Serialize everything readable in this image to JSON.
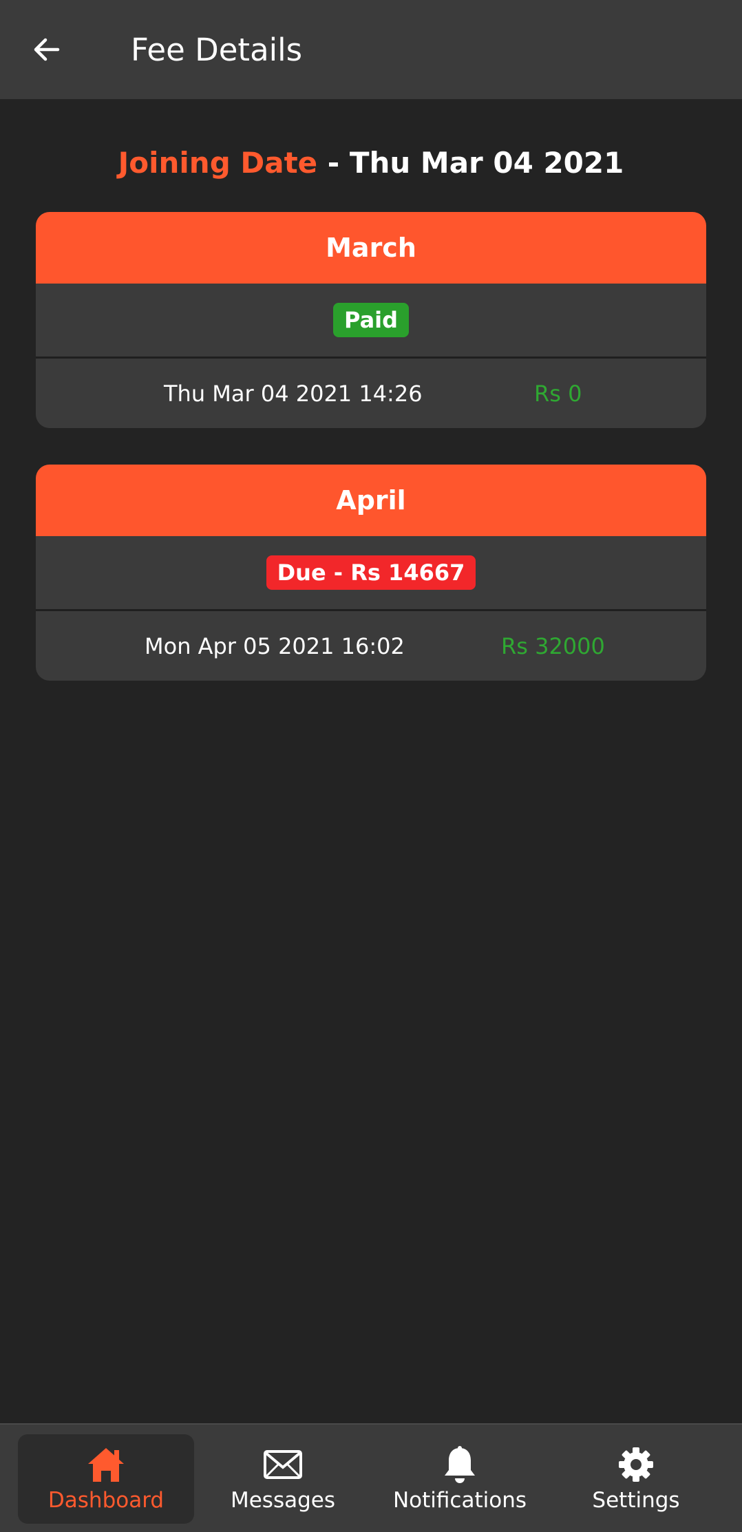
{
  "appbar": {
    "title": "Fee Details",
    "back_icon": "arrow-left-icon"
  },
  "joining": {
    "label": "Joining Date",
    "separator": " - ",
    "date": "Thu Mar 04 2021"
  },
  "colors": {
    "accent": "#ff562d",
    "paid": "#2aa02c",
    "due": "#f2272a",
    "amount": "#2fa832"
  },
  "fees": [
    {
      "month": "March",
      "status": "Paid",
      "status_type": "paid",
      "datetime": "Thu Mar 04 2021 14:26",
      "amount": "Rs 0"
    },
    {
      "month": "April",
      "status": "Due - Rs 14667",
      "status_type": "due",
      "datetime": "Mon Apr 05 2021 16:02",
      "amount": "Rs 32000"
    }
  ],
  "nav": {
    "items": [
      {
        "label": "Dashboard",
        "icon": "home-icon",
        "active": true
      },
      {
        "label": "Messages",
        "icon": "envelope-icon",
        "active": false
      },
      {
        "label": "Notifications",
        "icon": "bell-icon",
        "active": false
      },
      {
        "label": "Settings",
        "icon": "gear-icon",
        "active": false
      }
    ]
  }
}
